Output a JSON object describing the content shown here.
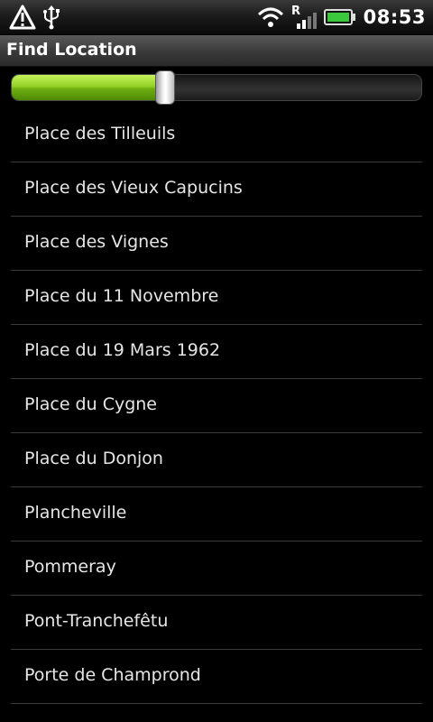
{
  "status_bar": {
    "time": "08:53",
    "icons": [
      "alert-icon",
      "usb-icon",
      "wifi-icon",
      "roaming-signal-icon",
      "battery-icon"
    ],
    "roaming_indicator": "R",
    "battery_color": "#3cc83c"
  },
  "title_bar": {
    "title": "Find Location"
  },
  "slider": {
    "value": 0.376,
    "fill_color": "#94d128"
  },
  "list": {
    "items": [
      {
        "label": "Place des Tilleuils"
      },
      {
        "label": "Place des Vieux Capucins"
      },
      {
        "label": "Place des Vignes"
      },
      {
        "label": "Place du 11 Novembre"
      },
      {
        "label": "Place du 19 Mars 1962"
      },
      {
        "label": "Place du Cygne"
      },
      {
        "label": "Place du Donjon"
      },
      {
        "label": "Plancheville"
      },
      {
        "label": "Pommeray"
      },
      {
        "label": "Pont-Tranchefêtu"
      },
      {
        "label": "Porte de Champrond"
      }
    ]
  }
}
